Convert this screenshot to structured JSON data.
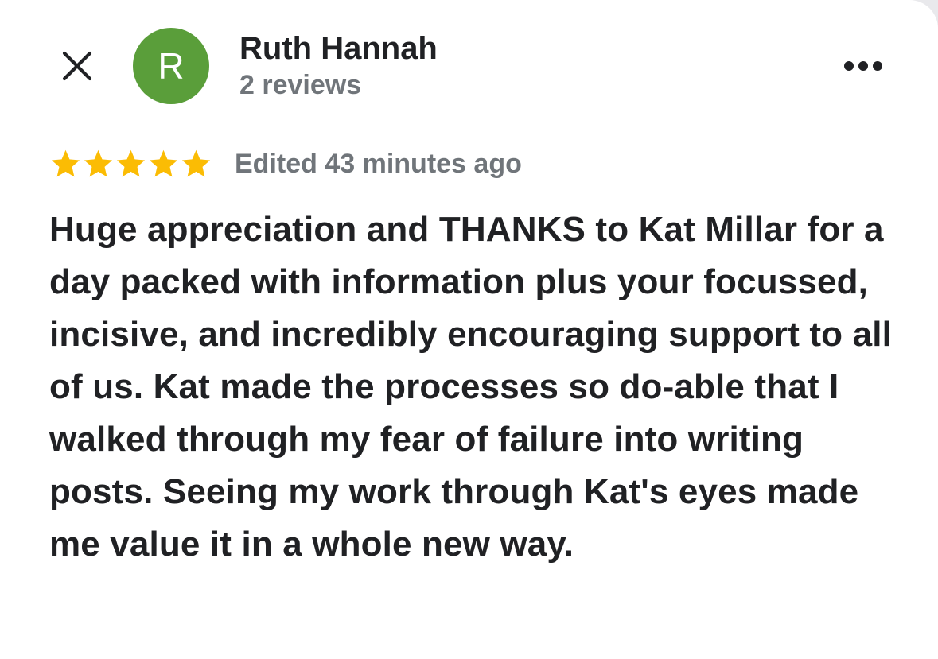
{
  "header": {
    "close_label": "Close",
    "author_initial": "R",
    "author_name": "Ruth Hannah",
    "review_count": "2 reviews",
    "more_label": "More options"
  },
  "review": {
    "rating": 5,
    "rating_max": 5,
    "edited": "Edited 43 minutes ago",
    "text": "Huge appreciation and THANKS to Kat Millar for a day packed with information plus your focussed, incisive, and incredibly encouraging support to all of us. Kat made the processes so do-able that I walked through my fear of failure into writing posts. Seeing my work through Kat's eyes made me value it in a whole new way."
  },
  "icons": {
    "close": "close-icon",
    "more": "more-horizontal-icon",
    "star": "star-icon"
  },
  "colors": {
    "avatar_bg": "#5a9e3a",
    "star": "#fbbc04",
    "text_primary": "#202124",
    "text_secondary": "#70757a"
  }
}
